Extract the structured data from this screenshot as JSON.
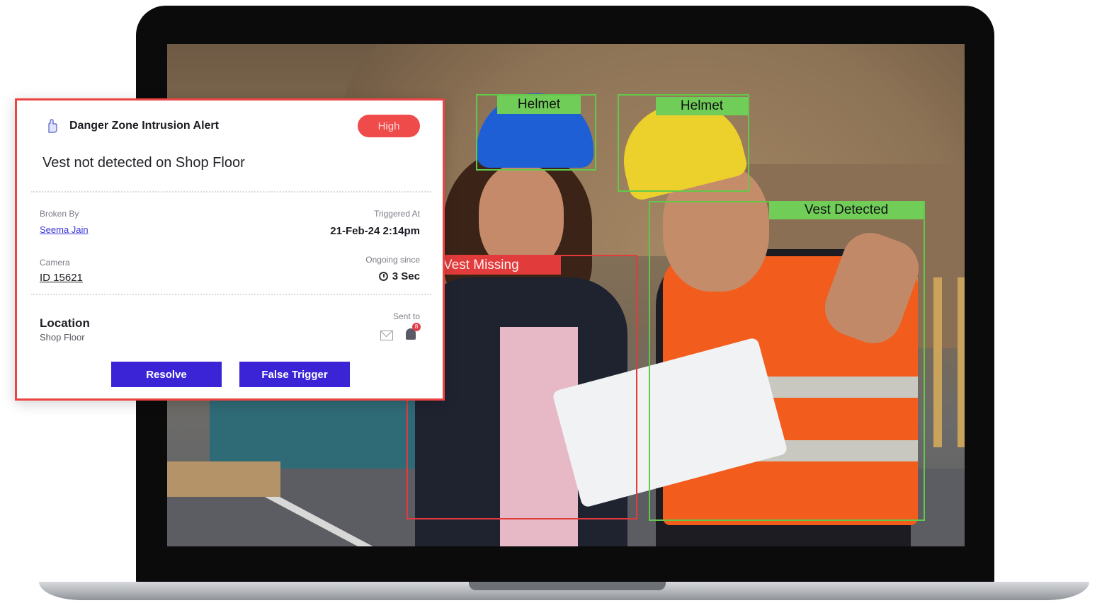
{
  "alert": {
    "title": "Danger Zone Intrusion Alert",
    "severity": "High",
    "message": "Vest not detected on Shop Floor",
    "broken_by_label": "Broken By",
    "broken_by_value": "Seema Jain",
    "triggered_at_label": "Triggered At",
    "triggered_at_value": "21-Feb-24 2:14pm",
    "camera_label": "Camera",
    "camera_value": "ID 15621",
    "ongoing_label": "Ongoing since",
    "ongoing_value": "3 Sec",
    "location_label": "Location",
    "location_value": "Shop Floor",
    "sent_to_label": "Sent to",
    "notification_count": "8",
    "resolve_label": "Resolve",
    "false_trigger_label": "False Trigger"
  },
  "detections": [
    {
      "label": "Helmet",
      "status": "detected",
      "color": "#62c84a"
    },
    {
      "label": "Helmet",
      "status": "detected",
      "color": "#62c84a"
    },
    {
      "label": "Vest Detected",
      "status": "detected",
      "color": "#62c84a"
    },
    {
      "label": "Vest Missing",
      "status": "missing",
      "color": "#e23b3b"
    }
  ],
  "icons": {
    "alert": "alert-hand-icon",
    "clock": "clock-icon",
    "mail": "mail-icon",
    "bell": "bell-icon"
  },
  "colors": {
    "accent": "#3a24d6",
    "danger": "#ec4343",
    "detected": "#62c84a"
  }
}
